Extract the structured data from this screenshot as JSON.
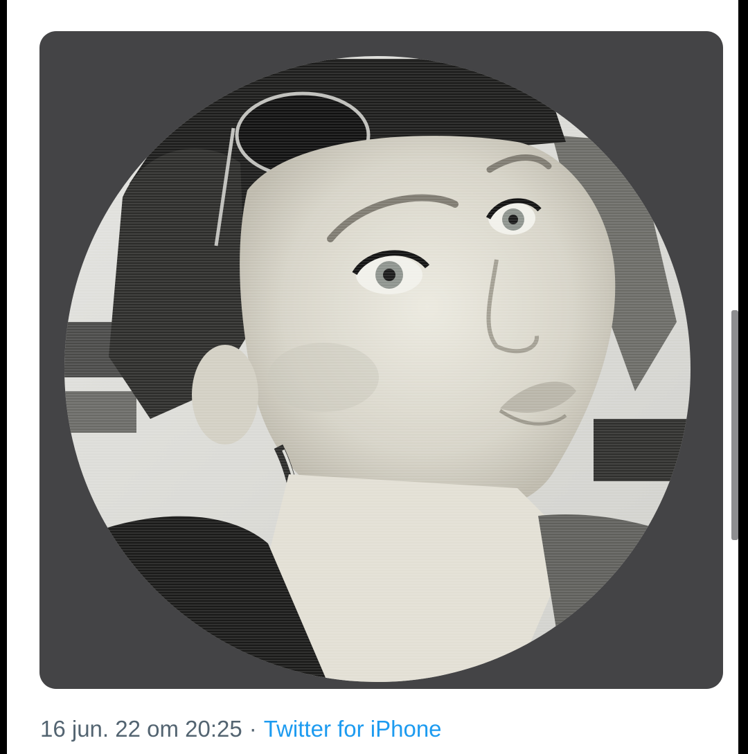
{
  "tweet": {
    "date": "16 jun. 22",
    "at_word": "om",
    "time": "20:25",
    "separator": "·",
    "source": "Twitter for iPhone"
  },
  "media": {
    "icon": "photo-icon",
    "subject": "black-and-white profile photo in a circular frame"
  },
  "colors": {
    "card_background": "#444446",
    "meta_text": "#536471",
    "source_link": "#1d9bf0",
    "page_background": "#ffffff",
    "frame": "#000000"
  }
}
